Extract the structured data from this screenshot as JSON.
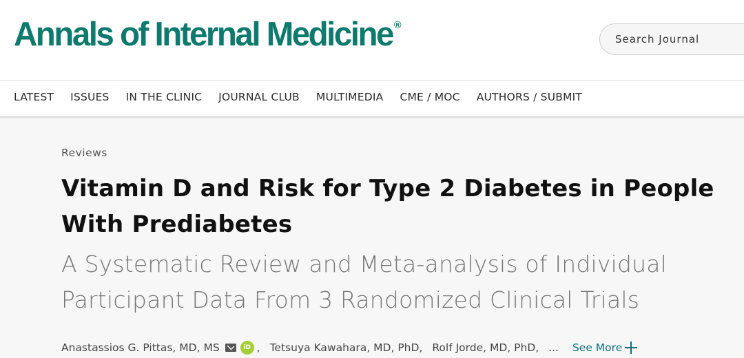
{
  "header": {
    "logo_text": "Annals of Internal Medicine",
    "logo_mark": "®",
    "search_placeholder": "Search Journal"
  },
  "nav": {
    "items": [
      "LATEST",
      "ISSUES",
      "IN THE CLINIC",
      "JOURNAL CLUB",
      "MULTIMEDIA",
      "CME / MOC",
      "AUTHORS / SUBMIT"
    ]
  },
  "article": {
    "category": "Reviews",
    "title": "Vitamin D and Risk for Type 2 Diabetes in People With Prediabetes",
    "subtitle": "A Systematic Review and Meta-analysis of Individual Participant Data From 3 Randomized Clinical Trials",
    "authors": [
      "Anastassios G. Pittas, MD, MS",
      "Tetsuya Kawahara, MD, PhD,",
      "Rolf Jorde, MD, PhD,"
    ],
    "ellipsis": "...",
    "see_more": "See More",
    "orcid_label": "iD"
  },
  "colors": {
    "brand": "#0e7a6d",
    "link": "#0e6e7a",
    "orcid": "#a6ce39"
  }
}
